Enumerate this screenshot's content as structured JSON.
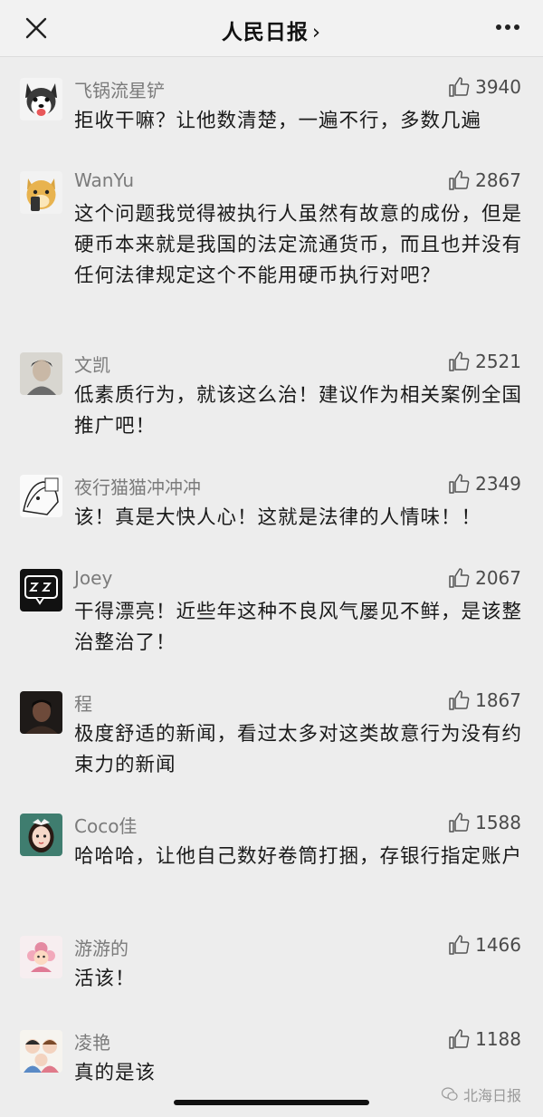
{
  "navbar": {
    "title": "人民日报",
    "title_suffix": "›"
  },
  "comments": [
    {
      "name": "飞锅流星铲",
      "likes": "3940",
      "text": "拒收干嘛？让他数清楚，一遍不行，多数几遍",
      "avatar": "husky-avatar"
    },
    {
      "name": "WanYu",
      "likes": "2867",
      "text": "这个问题我觉得被执行人虽然有故意的成份，但是硬币本来就是我国的法定流通货币，而且也并没有任何法律规定这个不能用硬币执行对吧？",
      "avatar": "doge-phone-avatar"
    },
    {
      "name": "文凯",
      "likes": "2521",
      "text": "低素质行为，就该这么治！建议作为相关案例全国推广吧！",
      "avatar": "person-photo-avatar"
    },
    {
      "name": "夜行猫猫冲冲冲",
      "likes": "2349",
      "text": "该！真是大快人心！这就是法律的人情味！！",
      "avatar": "manga-avatar"
    },
    {
      "name": "Joey",
      "likes": "2067",
      "text": "干得漂亮！近些年这种不良风气屡见不鲜，是该整治整治了！",
      "avatar": "zz-bubble-avatar"
    },
    {
      "name": "程",
      "likes": "1867",
      "text": "极度舒适的新闻，看过太多对这类故意行为没有约束力的新闻",
      "avatar": "dark-portrait-avatar"
    },
    {
      "name": "Coco佳",
      "likes": "1588",
      "text": "哈哈哈，让他自己数好卷筒打捆，存银行指定账户",
      "avatar": "cartoon-girl-avatar"
    },
    {
      "name": "游游的",
      "likes": "1466",
      "text": "活该！",
      "avatar": "pink-flower-avatar"
    },
    {
      "name": "凌艳",
      "likes": "1188",
      "text": "真的是该",
      "avatar": "family-cartoon-avatar"
    }
  ],
  "watermark": {
    "text": "北海日报"
  },
  "colors": {
    "background": "#ededed",
    "name": "#7b7b7b",
    "text": "#1a1a1a"
  }
}
